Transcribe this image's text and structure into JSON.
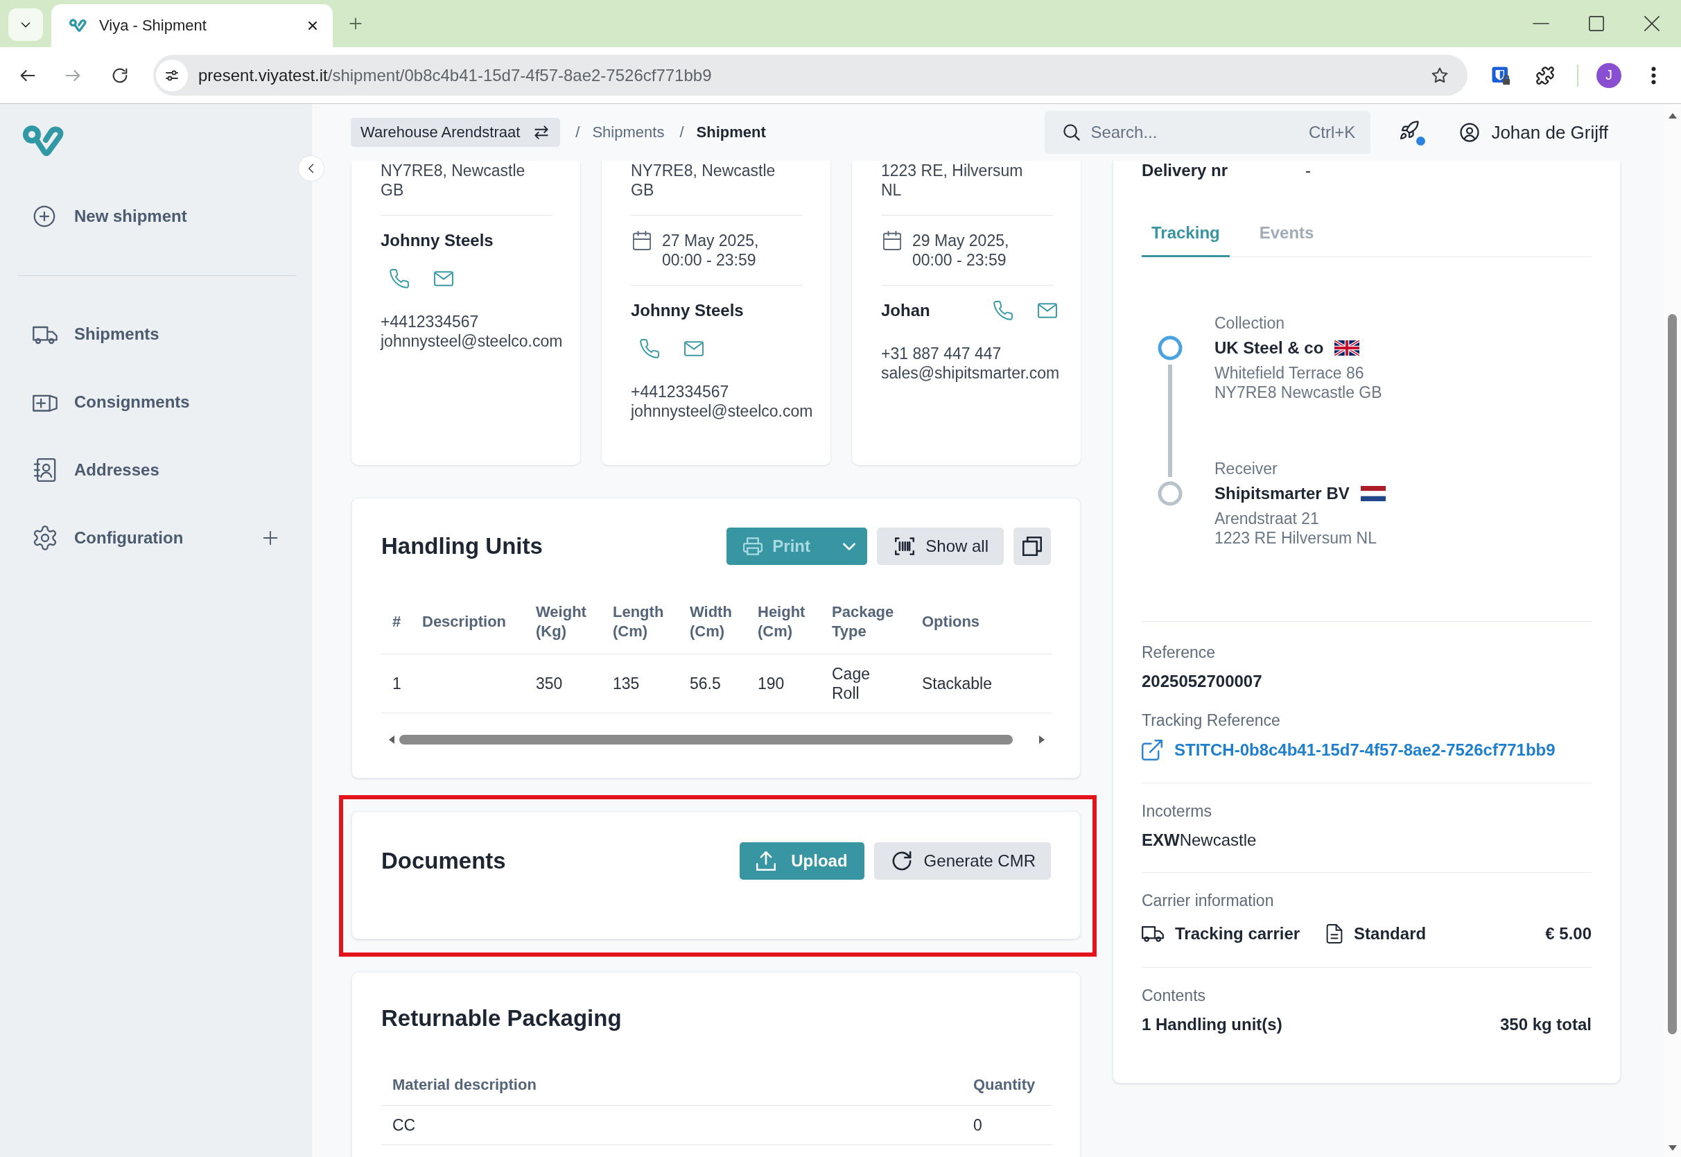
{
  "browser": {
    "tab_title": "Viya - Shipment",
    "url_host": "present.viyatest.it",
    "url_path": "/shipment/0b8c4b41-15d7-4f57-8ae2-7526cf771bb9",
    "can_go_forward": false,
    "profile_initial": "J"
  },
  "sidebar": {
    "new_shipment": "New shipment",
    "items": [
      {
        "label": "Shipments",
        "selected": false,
        "expandable": false
      },
      {
        "label": "Consignments",
        "selected": false,
        "expandable": false
      },
      {
        "label": "Addresses",
        "selected": false,
        "expandable": false
      },
      {
        "label": "Configuration",
        "selected": false,
        "expandable": true
      }
    ]
  },
  "header": {
    "location": "Warehouse Arendstraat",
    "breadcrumbs": [
      {
        "separator": "/",
        "label": "Shipments",
        "current": false
      },
      {
        "separator": "/",
        "label": "Shipment",
        "current": true
      }
    ],
    "search": {
      "placeholder": "Search...",
      "shortcut": "Ctrl+K"
    },
    "notification": true,
    "user_name": "Johan de Grijff"
  },
  "address_cards": [
    {
      "address_lines": [
        "NY7RE8, Newcastle",
        "GB"
      ],
      "contact_name": "Johnny Steels",
      "phone": "+4412334567",
      "email": "johnnysteel@steelco.com"
    },
    {
      "address_lines": [
        "NY7RE8, Newcastle",
        "GB"
      ],
      "date_lines": [
        "27 May 2025,",
        "00:00 - 23:59"
      ],
      "contact_name": "Johnny Steels",
      "phone": "+4412334567",
      "email": "johnnysteel@steelco.com"
    },
    {
      "address_lines": [
        "1223 RE, Hilversum",
        "NL"
      ],
      "date_lines": [
        "29 May 2025,",
        "00:00 - 23:59"
      ],
      "contact_name": "Johan",
      "phone": "+31 887 447 447",
      "email": "sales@shipitsmarter.com"
    }
  ],
  "handling_units": {
    "title": "Handling Units",
    "print": {
      "label": "Print",
      "disabled": true
    },
    "show_all": "Show all",
    "columns": [
      "#",
      "Description",
      "Weight (Kg)",
      "Length (Cm)",
      "Width (Cm)",
      "Height (Cm)",
      "Package Type",
      "Options"
    ],
    "rows": [
      [
        "1",
        null,
        "350",
        "135",
        "56.5",
        "190",
        "Cage Roll",
        "Stackable"
      ]
    ]
  },
  "documents": {
    "title": "Documents",
    "highlighted": true,
    "upload": "Upload",
    "generate": "Generate CMR"
  },
  "returnable_packaging": {
    "title": "Returnable Packaging",
    "columns": [
      "Material description",
      "Quantity"
    ],
    "rows": [
      [
        "CC",
        "0"
      ]
    ]
  },
  "details": {
    "delivery_nr": {
      "label": "Delivery nr",
      "value": "-"
    },
    "tabs": [
      {
        "label": "Tracking",
        "selected": true
      },
      {
        "label": "Events",
        "selected": false
      }
    ],
    "stops": [
      {
        "label": "Collection",
        "name": "UK Steel & co",
        "address_lines": [
          "Whitefield Terrace 86",
          "NY7RE8 Newcastle GB"
        ],
        "active": true
      },
      {
        "label": "Receiver",
        "name": "Shipitsmarter BV",
        "address_lines": [
          "Arendstraat 21",
          "1223 RE Hilversum NL"
        ],
        "active": false
      }
    ],
    "reference": {
      "label": "Reference",
      "value": "2025052700007"
    },
    "tracking_reference": {
      "label": "Tracking Reference",
      "value": "STITCH-0b8c4b41-15d7-4f57-8ae2-7526cf771bb9"
    },
    "incoterms": {
      "label": "Incoterms",
      "value": "**EXW**Newcastle"
    },
    "carrier": {
      "label": "Carrier information",
      "carrier": "Tracking carrier",
      "service": "Standard",
      "price": "€ 5.00"
    },
    "contents": {
      "label": "Contents",
      "units": "1 Handling unit(s)",
      "weight": "350 kg total"
    }
  }
}
